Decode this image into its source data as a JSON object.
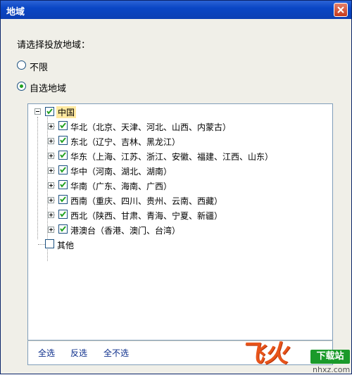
{
  "window": {
    "title": "地域"
  },
  "prompt": "请选择投放地域：",
  "options": [
    {
      "label": "不限",
      "selected": false
    },
    {
      "label": "自选地域",
      "selected": true
    }
  ],
  "tree": {
    "root": {
      "label": "中国",
      "checked": true
    },
    "regions": [
      {
        "label": "华北（北京、天津、河北、山西、内蒙古）",
        "checked": true
      },
      {
        "label": "东北（辽宁、吉林、黑龙江）",
        "checked": true
      },
      {
        "label": "华东（上海、江苏、浙江、安徽、福建、江西、山东）",
        "checked": true
      },
      {
        "label": "华中（河南、湖北、湖南）",
        "checked": true
      },
      {
        "label": "华南（广东、海南、广西）",
        "checked": true
      },
      {
        "label": "西南（重庆、四川、贵州、云南、西藏）",
        "checked": true
      },
      {
        "label": "西北（陕西、甘肃、青海、宁夏、新疆）",
        "checked": true
      },
      {
        "label": "港澳台（香港、澳门、台湾）",
        "checked": true
      }
    ],
    "other": {
      "label": "其他",
      "checked": false
    }
  },
  "footer": {
    "select_all": "全选",
    "invert": "反选",
    "select_none": "全不选"
  },
  "watermark": {
    "logo": "飞火",
    "badge": "下载站",
    "url": "nhxz.com"
  },
  "colors": {
    "title_bar": "#0a46c4",
    "radio_selected": "#21a121",
    "check_mark": "#21a121",
    "link": "#0b2d8b",
    "root_highlight": "#ffe9a0"
  }
}
